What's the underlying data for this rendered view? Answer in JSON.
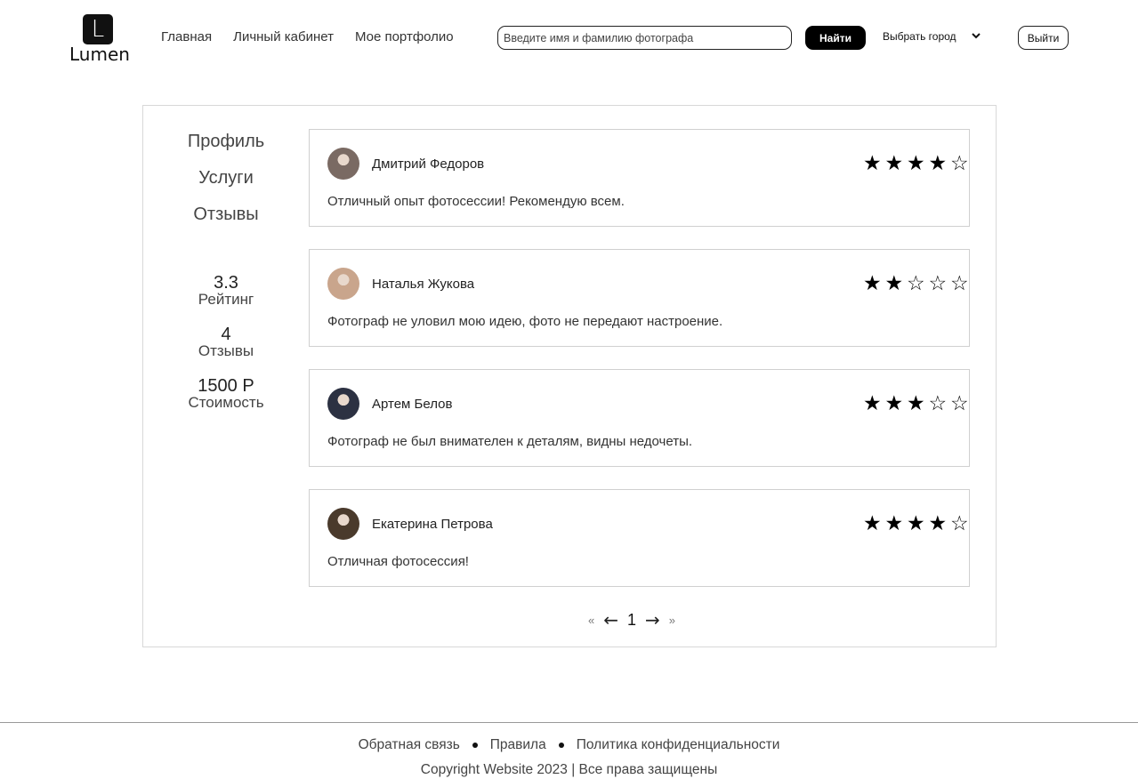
{
  "header": {
    "logo_letter": "L",
    "logo_text": "Lumen",
    "nav": [
      "Главная",
      "Личный кабинет",
      "Мое портфолио"
    ],
    "search_placeholder": "Введите имя и фамилию фотографа",
    "find_label": "Найти",
    "city_label": "Выбрать город",
    "logout_label": "Выйти"
  },
  "side_menu": [
    "Профиль",
    "Услуги",
    "Отзывы"
  ],
  "stats": [
    {
      "value": "3.3",
      "label": "Рейтинг"
    },
    {
      "value": "4",
      "label": "Отзывы"
    },
    {
      "value": "1500 Р",
      "label": "Стоимость"
    }
  ],
  "reviews": [
    {
      "name": "Дмитрий Федоров",
      "rating": 4,
      "text": "Отличный опыт фотосессии! Рекомендую всем.",
      "avatar_color": "#7a6a63"
    },
    {
      "name": "Наталья Жукова",
      "rating": 2,
      "text": "Фотограф не уловил мою идею, фото не передают настроение.",
      "avatar_color": "#c9a58c"
    },
    {
      "name": "Артем Белов",
      "rating": 3,
      "text": "Фотограф не был внимателен к деталям, видны недочеты.",
      "avatar_color": "#2c3142"
    },
    {
      "name": "Екатерина Петрова",
      "rating": 4,
      "text": "Отличная фотосессия!",
      "avatar_color": "#4a3a2c"
    }
  ],
  "pagination": {
    "first": "«",
    "prev": "←",
    "current": "1",
    "next": "→",
    "last": "»"
  },
  "footer": {
    "links": [
      "Обратная связь",
      "Правила",
      "Политика конфиденциальности"
    ],
    "copyright": "Copyright Website 2023 | Все права защищены"
  }
}
